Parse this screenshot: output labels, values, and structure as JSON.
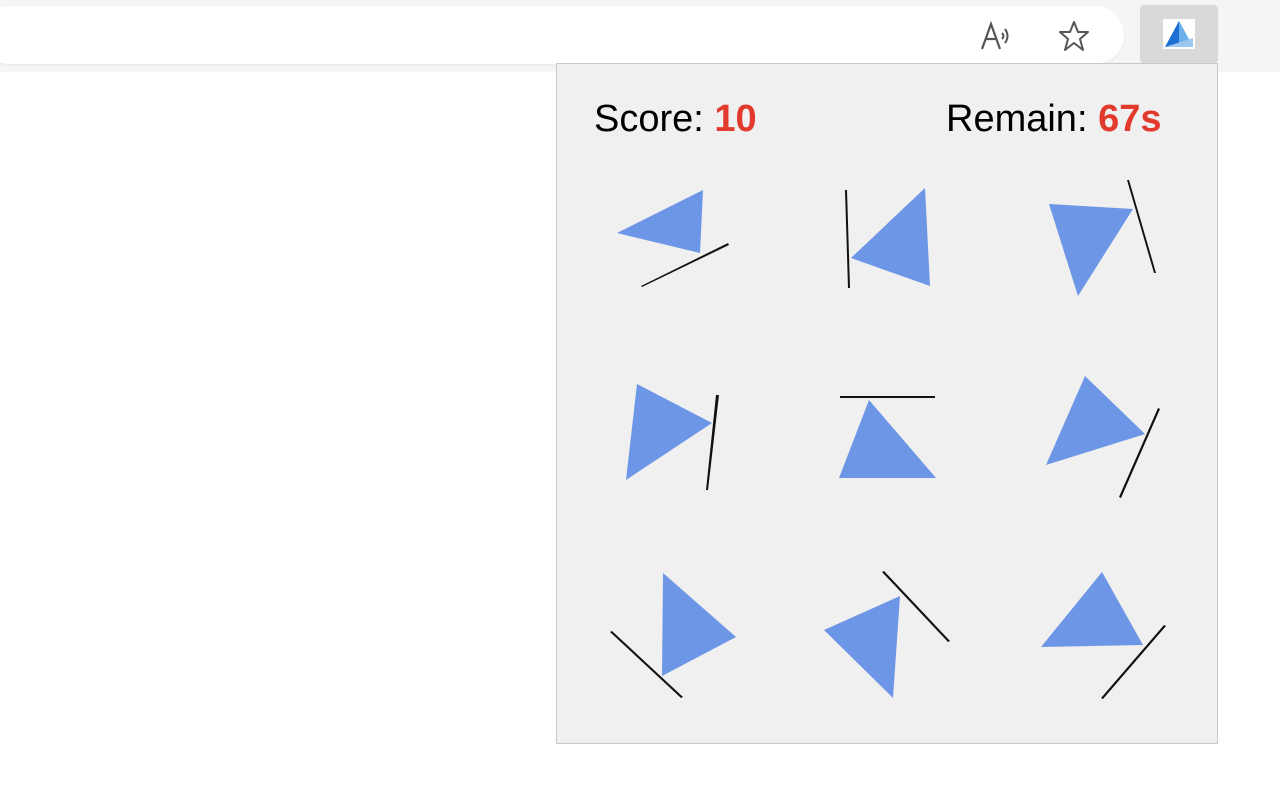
{
  "hud": {
    "score_label": "Score: ",
    "score_value": "10",
    "remain_label": "Remain: ",
    "remain_value": "67s"
  },
  "toolbar": {
    "read_aloud_icon": "read-aloud-icon",
    "favorite_icon": "star-icon",
    "extension_icon": "triangle-game-extension-icon"
  },
  "colors": {
    "triangle": "#6d96e6",
    "value_red": "#e23b2e",
    "popup_bg": "#f0f0f0"
  },
  "grid": {
    "rows": 3,
    "cols": 3,
    "cells": [
      {
        "row": 1,
        "col": 1,
        "shape": "triangle-with-line"
      },
      {
        "row": 1,
        "col": 2,
        "shape": "triangle-with-line"
      },
      {
        "row": 1,
        "col": 3,
        "shape": "triangle-with-line"
      },
      {
        "row": 2,
        "col": 1,
        "shape": "triangle-with-line"
      },
      {
        "row": 2,
        "col": 2,
        "shape": "triangle-with-line"
      },
      {
        "row": 2,
        "col": 3,
        "shape": "triangle-with-line"
      },
      {
        "row": 3,
        "col": 1,
        "shape": "triangle-with-line"
      },
      {
        "row": 3,
        "col": 2,
        "shape": "triangle-with-line"
      },
      {
        "row": 3,
        "col": 3,
        "shape": "triangle-with-line"
      }
    ]
  }
}
